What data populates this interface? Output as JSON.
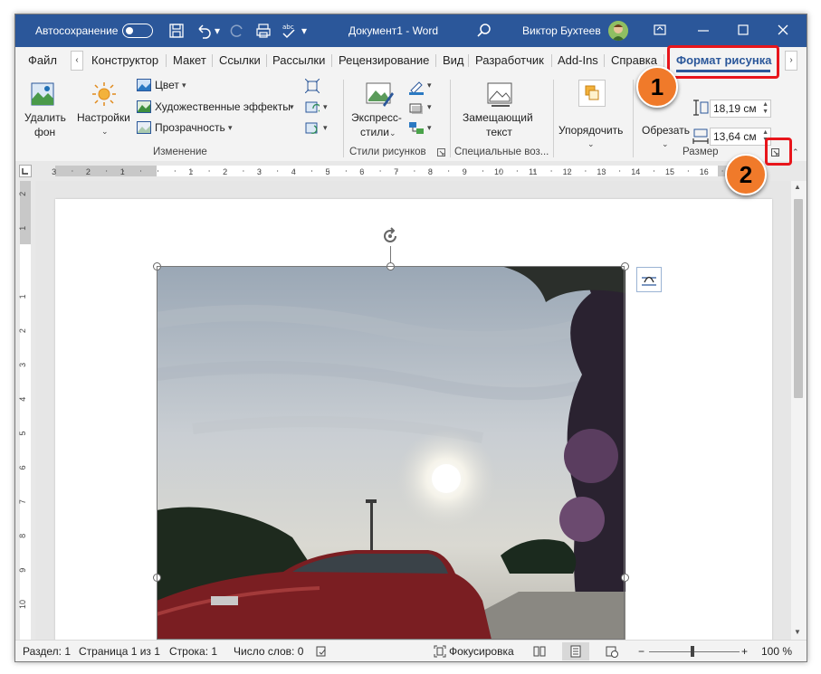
{
  "titlebar": {
    "autosave_label": "Автосохранение",
    "doc_title": "Документ1  -  Word",
    "user_name": "Виктор Бухтеев"
  },
  "tabs": [
    {
      "label": "Файл"
    },
    {
      "label": "Конструктор"
    },
    {
      "label": "Макет"
    },
    {
      "label": "Ссылки"
    },
    {
      "label": "Рассылки"
    },
    {
      "label": "Рецензирование"
    },
    {
      "label": "Вид"
    },
    {
      "label": "Разработчик"
    },
    {
      "label": "Add-Ins"
    },
    {
      "label": "Справка"
    },
    {
      "label": "Формат рисунка",
      "active": true
    }
  ],
  "ribbon": {
    "remove_bg": "Удалить\nфон",
    "remove_bg_l1": "Удалить",
    "remove_bg_l2": "фон",
    "corrections": "Настройки",
    "color": "Цвет",
    "artistic": "Художественные эффекты",
    "transparency": "Прозрачность",
    "group_adjust": "Изменение",
    "quick_styles_l1": "Экспресс-",
    "quick_styles_l2": "стили",
    "group_styles": "Стили рисунков",
    "alt_text_l1": "Замещающий",
    "alt_text_l2": "текст",
    "group_access": "Специальные воз...",
    "arrange": "Упорядочить",
    "crop": "Обрезать",
    "height": "18,19 см",
    "width": "13,64 см",
    "group_size": "Размер"
  },
  "status": {
    "section": "Раздел: 1",
    "page": "Страница 1 из 1",
    "line": "Строка: 1",
    "words": "Число слов: 0",
    "focus": "Фокусировка",
    "zoom": "100 %"
  },
  "callouts": {
    "one": "1",
    "two": "2"
  },
  "ruler_labels": [
    "3",
    "2",
    "1",
    "1",
    "2",
    "3",
    "4",
    "5",
    "6",
    "7",
    "8",
    "9",
    "10",
    "11",
    "12",
    "13",
    "14",
    "15",
    "16",
    "17"
  ],
  "vruler_labels": [
    "2",
    "1",
    "1",
    "2",
    "3",
    "4",
    "5",
    "6",
    "7",
    "8",
    "9",
    "10"
  ],
  "colors": {
    "accent": "#2b579a",
    "callout": "#f07a2a",
    "highlight": "#e8151b"
  }
}
